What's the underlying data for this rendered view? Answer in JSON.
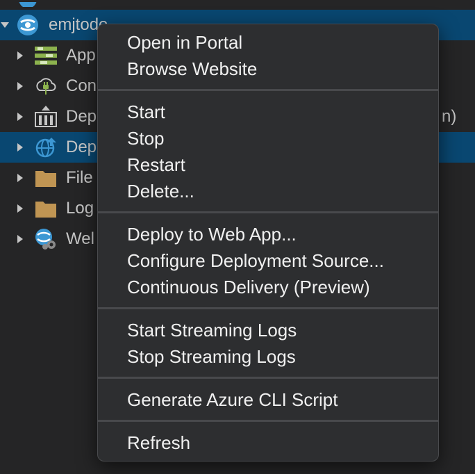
{
  "tree": {
    "root": {
      "label": "emjtodo",
      "icon": "azure-app-service-icon"
    },
    "items": [
      {
        "label": "App",
        "icon": "app-settings-icon"
      },
      {
        "label": "Con",
        "icon": "connections-icon"
      },
      {
        "label": "Dep",
        "icon": "deployments-icon",
        "suffix": "n)"
      },
      {
        "label": "Dep",
        "icon": "deployment-globe-icon",
        "selected": true
      },
      {
        "label": "File",
        "icon": "folder-icon"
      },
      {
        "label": "Log",
        "icon": "folder-icon"
      },
      {
        "label": "Wel",
        "icon": "webjobs-icon"
      }
    ]
  },
  "context_menu": {
    "groups": [
      [
        "Open in Portal",
        "Browse Website"
      ],
      [
        "Start",
        "Stop",
        "Restart",
        "Delete..."
      ],
      [
        "Deploy to Web App...",
        "Configure Deployment Source...",
        "Continuous Delivery (Preview)"
      ],
      [
        "Start Streaming Logs",
        "Stop Streaming Logs"
      ],
      [
        "Generate Azure CLI Script"
      ],
      [
        "Refresh"
      ]
    ]
  },
  "colors": {
    "background": "#252526",
    "selection": "#094771",
    "menu_background": "#2d2e30",
    "menu_text": "#f0f0f0"
  }
}
